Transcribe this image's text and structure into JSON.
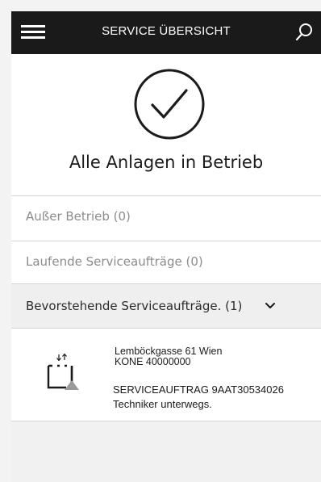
{
  "header": {
    "title": "SERVICE ÜBERSICHT",
    "menu_icon": "hamburger-menu-icon",
    "search_icon": "search-icon"
  },
  "status": {
    "icon": "check-circle-icon",
    "text": "Alle Anlagen in Betrieb"
  },
  "sections": [
    {
      "label": "Außer Betrieb (0)"
    },
    {
      "label": "Laufende Serviceaufträge (0)"
    },
    {
      "label": "Bevorstehende Serviceaufträge. (1)",
      "icon": "chevron-down-icon"
    }
  ],
  "order": {
    "icon": "elevator-icon",
    "address": "Lemböckgasse 61 Wien",
    "equipment": "KONE 40000000",
    "order_number": "SERVICEAUFTRAG 9AAT30534026",
    "status": "Techniker unterwegs."
  },
  "colors": {
    "header_bg": "#1a1a1a",
    "muted_text": "#8c8c8c",
    "expanded_row_bg": "#efefef"
  }
}
